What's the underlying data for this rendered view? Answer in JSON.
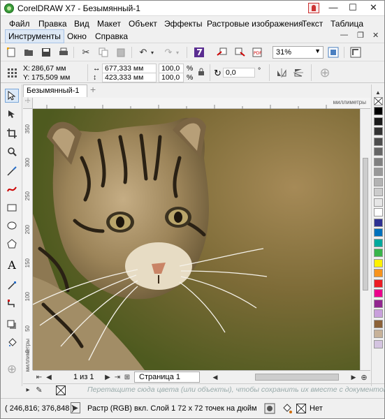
{
  "window": {
    "title": "CorelDRAW X7 - Безымянный-1",
    "minimize": "—",
    "maximize": "☐",
    "close": "✕"
  },
  "menu_row1": [
    {
      "label": "Файл"
    },
    {
      "label": "Правка"
    },
    {
      "label": "Вид"
    },
    {
      "label": "Макет"
    },
    {
      "label": "Объект"
    },
    {
      "label": "Эффекты"
    },
    {
      "label": "Растровые изображения"
    },
    {
      "label": "Текст"
    },
    {
      "label": "Таблица"
    }
  ],
  "menu_row2": [
    {
      "label": "Инструменты"
    },
    {
      "label": "Окно"
    },
    {
      "label": "Справка"
    }
  ],
  "toolbar": {
    "zoom_value": "31%"
  },
  "property_bar": {
    "x_label": "X:",
    "x_value": "286,67 мм",
    "y_label": "Y:",
    "y_value": "175,509 мм",
    "width_value": "677,333 мм",
    "height_value": "423,333 мм",
    "scale_w": "100,0",
    "scale_h": "100,0",
    "percent_w": "%",
    "percent_h": "%",
    "angle_value": "0,0",
    "degree": "°"
  },
  "document": {
    "tab_label": "Безымянный-1",
    "add_tab": "+"
  },
  "rulers": {
    "top_units": "миллиметры",
    "left_units": "миллиметры",
    "left_ticks": [
      "350",
      "300",
      "250",
      "200",
      "150",
      "100",
      "50",
      "0"
    ]
  },
  "page_nav": {
    "count": "1 из 1",
    "page_tab": "Страница 1"
  },
  "palette_hint": "Перетащите сюда цвета (или объекты), чтобы сохранить их вместе с документом.",
  "palette_colors": [
    "#000000",
    "#1a1a1a",
    "#333333",
    "#4d4d4d",
    "#666666",
    "#808080",
    "#999999",
    "#b3b3b3",
    "#cccccc",
    "#e6e6e6",
    "#ffffff",
    "#2e3192",
    "#0071bc",
    "#00a99d",
    "#39b54a",
    "#fff200",
    "#f7941d",
    "#ed1c24",
    "#ec008c",
    "#92278f",
    "#c9a0dc",
    "#8c6239",
    "#c7b299",
    "#d4c4e0"
  ],
  "status": {
    "coords": "( 246,816; 376,848 )",
    "play": "▶",
    "info": "Растр (RGB) вкл. Слой 1 72 x 72 точек на дюйм",
    "fill_none": "Нет"
  }
}
